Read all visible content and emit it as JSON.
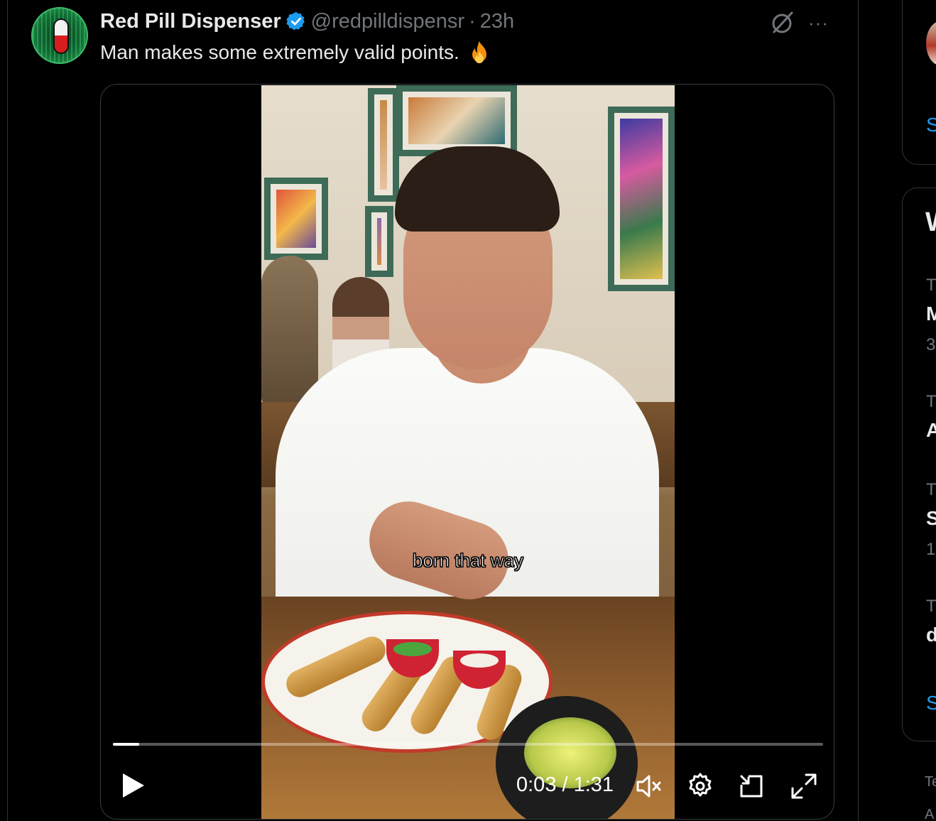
{
  "tweet": {
    "display_name": "Red Pill Dispenser",
    "handle": "@redpilldispensr",
    "separator": "·",
    "time": "23h",
    "text": "Man makes some extremely valid points.",
    "emoji": "fire-emoji"
  },
  "video": {
    "caption": "born that way",
    "current_time": "0:03",
    "duration": "1:31",
    "time_display": "0:03 / 1:31",
    "progress_fraction": 0.037
  },
  "icons": {
    "verified": "verified-badge-icon",
    "grok": "grok-icon",
    "more": "more-options-icon",
    "play": "play-icon",
    "mute": "muted-volume-icon",
    "settings": "gear-icon",
    "pip": "picture-in-picture-icon",
    "fullscreen": "fullscreen-icon"
  },
  "sidebar": {
    "card1_link": "S",
    "card2_title": "W",
    "trends": [
      {
        "category": "T",
        "name": "M",
        "count": "3"
      },
      {
        "category": "T",
        "name": "A",
        "count": ""
      },
      {
        "category": "T",
        "name": "S",
        "count": "1!"
      },
      {
        "category": "T",
        "name": "d",
        "count": ""
      }
    ],
    "card2_link": "S",
    "footer_1": "Te",
    "footer_2": "A"
  },
  "colors": {
    "background": "#000000",
    "text_primary": "#e7e9ea",
    "text_secondary": "#71767b",
    "link": "#1d9bf0",
    "verified": "#1d9bf0",
    "border": "#2f3336"
  }
}
